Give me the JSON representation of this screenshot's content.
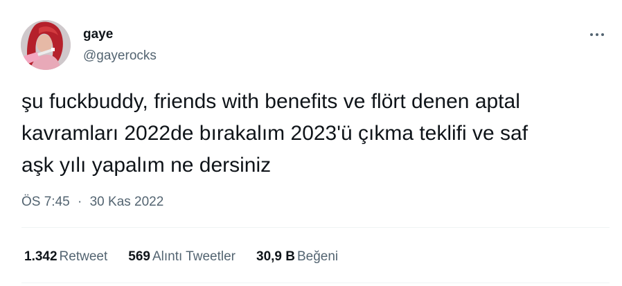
{
  "author": {
    "display_name": "gaye",
    "handle": "@gayerocks"
  },
  "tweet": {
    "text": "şu fuckbuddy, friends with benefits ve flört denen aptal\nkavramları 2022de bırakalım 2023'ü çıkma teklifi ve saf\naşk yılı yapalım ne dersiniz",
    "time": "ÖS 7:45",
    "separator": "·",
    "date": "30 Kas 2022"
  },
  "stats": {
    "retweets": {
      "count": "1.342",
      "label": "Retweet"
    },
    "quotes": {
      "count": "569",
      "label": "Alıntı Tweetler"
    },
    "likes": {
      "count": "30,9 B",
      "label": "Beğeni"
    }
  },
  "icons": {
    "more": "more-horizontal-icon"
  },
  "colors": {
    "text_primary": "#0f1419",
    "text_secondary": "#536471",
    "divider": "#eff3f4"
  }
}
